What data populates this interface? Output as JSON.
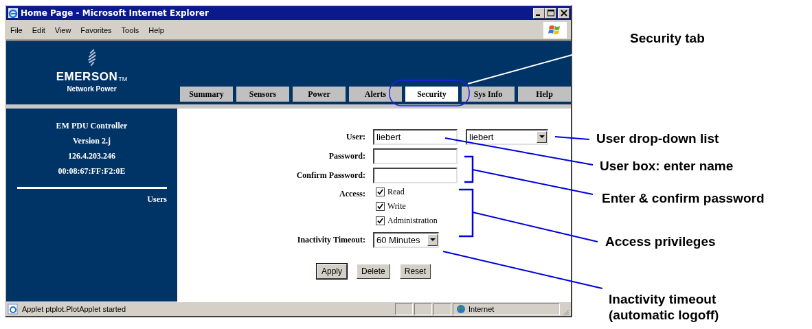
{
  "window": {
    "title": "Home Page - Microsoft Internet Explorer"
  },
  "menu": [
    "File",
    "Edit",
    "View",
    "Favorites",
    "Tools",
    "Help"
  ],
  "header": {
    "brand": "EMERSON",
    "trademark": "TM",
    "tagline": "Network Power"
  },
  "tabs": [
    {
      "label": "Summary",
      "selected": false
    },
    {
      "label": "Sensors",
      "selected": false
    },
    {
      "label": "Power",
      "selected": false
    },
    {
      "label": "Alerts",
      "selected": false
    },
    {
      "label": "Security",
      "selected": true
    },
    {
      "label": "Sys Info",
      "selected": false
    },
    {
      "label": "Help",
      "selected": false
    }
  ],
  "sidebar": {
    "info": [
      "EM PDU Controller",
      "Version 2.j",
      "126.4.203.246",
      "00:08:67:FF:F2:0E"
    ],
    "links": [
      "Users"
    ]
  },
  "form": {
    "user": {
      "label": "User:",
      "value": "liebert"
    },
    "user_select": {
      "value": "liebert"
    },
    "password": {
      "label": "Password:"
    },
    "confirm": {
      "label": "Confirm Password:"
    },
    "access": {
      "label": "Access:",
      "options": [
        {
          "label": "Read",
          "checked": true
        },
        {
          "label": "Write",
          "checked": true
        },
        {
          "label": "Administration",
          "checked": true
        }
      ]
    },
    "timeout": {
      "label": "Inactivity Timeout:",
      "value": "60 Minutes"
    },
    "buttons": [
      {
        "label": "Apply",
        "default": true
      },
      {
        "label": "Delete",
        "default": false
      },
      {
        "label": "Reset",
        "default": false
      }
    ]
  },
  "status_bar": {
    "message": "Applet ptplot.PlotApplet started",
    "zone": "Internet"
  },
  "callouts": [
    {
      "lines": [
        "Security tab"
      ]
    },
    {
      "lines": [
        "User drop-down list"
      ]
    },
    {
      "lines": [
        "User box: enter name"
      ]
    },
    {
      "lines": [
        "Enter & confirm password"
      ]
    },
    {
      "lines": [
        "Access privileges"
      ]
    },
    {
      "lines": [
        "Inactivity timeout",
        "(automatic logoff)"
      ]
    }
  ]
}
